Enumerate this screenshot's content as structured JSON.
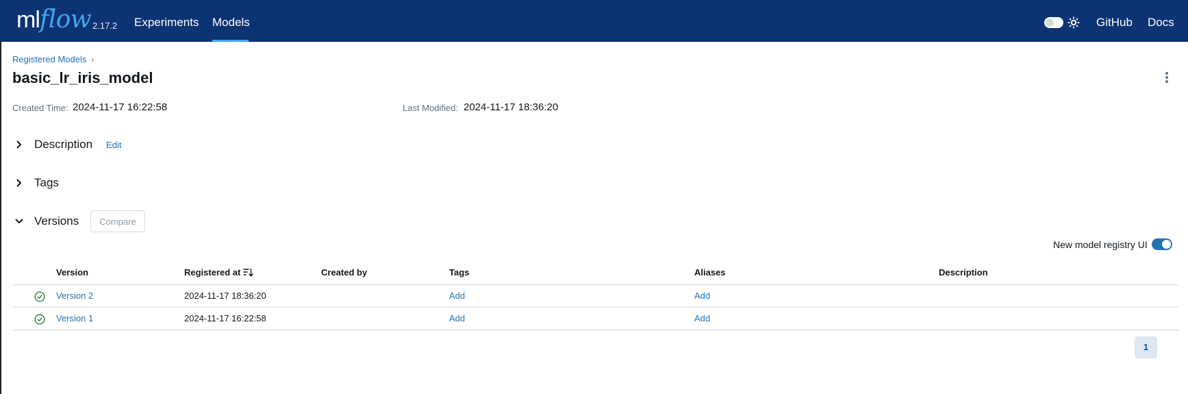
{
  "nav": {
    "logo_ml": "ml",
    "logo_flow": "flow",
    "version": "2.17.2",
    "links": {
      "experiments": "Experiments",
      "models": "Models",
      "github": "GitHub",
      "docs": "Docs"
    },
    "active": "Models",
    "theme_toggle": "off",
    "icons": {
      "theme_toggle": "toggle-switch-icon",
      "theme": "sun-icon"
    }
  },
  "breadcrumb": {
    "registered_models": "Registered Models",
    "separator": "›"
  },
  "page_title": "basic_lr_iris_model",
  "meta": {
    "created_label": "Created Time:",
    "created_value": "2024-11-17 16:22:58",
    "modified_label": "Last Modified:",
    "modified_value": "2024-11-17 18:36:20"
  },
  "sections": {
    "description": {
      "title": "Description",
      "edit": "Edit",
      "expanded": false
    },
    "tags": {
      "title": "Tags",
      "expanded": false
    },
    "versions": {
      "title": "Versions",
      "compare": "Compare",
      "expanded": true
    }
  },
  "registry_toggle": {
    "label": "New model registry UI",
    "enabled": true
  },
  "table": {
    "headers": {
      "version": "Version",
      "registered_at": "Registered at",
      "created_by": "Created by",
      "tags": "Tags",
      "aliases": "Aliases",
      "description": "Description"
    },
    "rows": [
      {
        "status": "ready",
        "version": "Version 2",
        "registered_at": "2024-11-17 18:36:20",
        "created_by": "",
        "tags": "Add",
        "aliases": "Add",
        "description": ""
      },
      {
        "status": "ready",
        "version": "Version 1",
        "registered_at": "2024-11-17 16:22:58",
        "created_by": "",
        "tags": "Add",
        "aliases": "Add",
        "description": ""
      }
    ]
  },
  "pagination": {
    "current_page": "1"
  },
  "colors": {
    "nav_bg": "#0c3373",
    "accent": "#43a6e8",
    "link": "#2272b4",
    "status_ok": "#277c43"
  }
}
